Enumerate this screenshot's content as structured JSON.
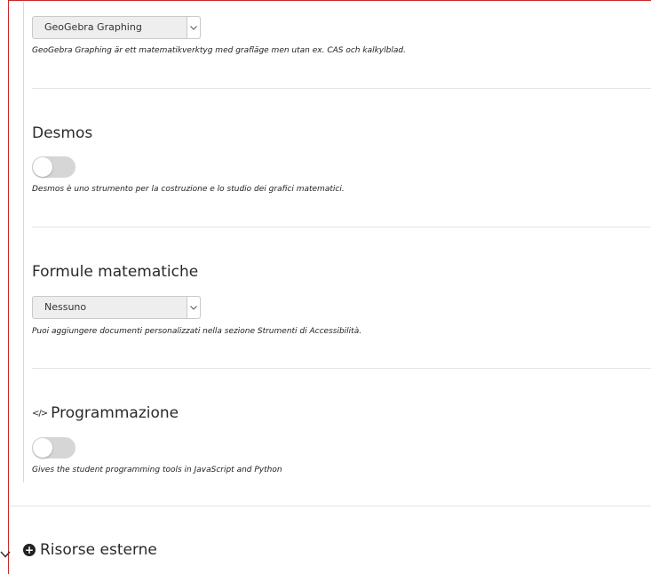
{
  "sections": {
    "geogebra": {
      "select_value": "GeoGebra Graphing",
      "description": "GeoGebra Graphing är ett matematikverktyg med grafläge men utan ex. CAS och kalkylblad."
    },
    "desmos": {
      "title": "Desmos",
      "enabled": false,
      "description": "Desmos è uno strumento per la costruzione e lo studio dei grafici matematici."
    },
    "formule": {
      "title": "Formule matematiche",
      "select_value": "Nessuno",
      "description": "Puoi aggiungere documenti personalizzati nella sezione Strumenti di Accessibilità."
    },
    "programmazione": {
      "title": "Programmazione",
      "icon": "code-icon",
      "icon_glyph": "</>",
      "enabled": false,
      "description": "Gives the student programming tools in JavaScript and Python"
    }
  },
  "external_resources": {
    "label": "Risorse esterne",
    "expand_icon": "chevron-down-icon",
    "add_icon": "plus-circle-icon"
  },
  "colors": {
    "frame_accent": "#c62828",
    "toggle_off": "#d6d6d6"
  }
}
